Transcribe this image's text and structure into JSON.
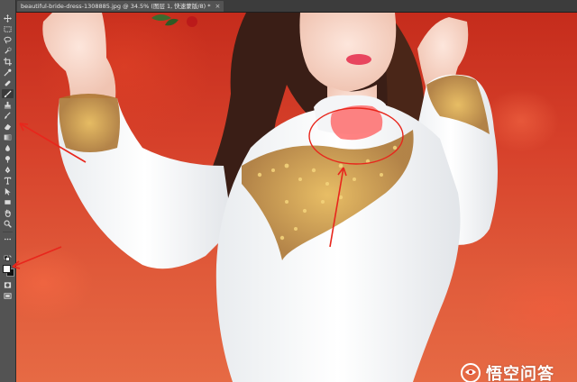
{
  "document_tab": {
    "title": "beautiful-bride-dress-1308885.jpg @ 34.5% (图层 1, 快速蒙版/8) *",
    "close_glyph": "×"
  },
  "toolbar": {
    "tools": [
      {
        "name": "move-tool-icon"
      },
      {
        "name": "marquee-tool-icon"
      },
      {
        "name": "lasso-tool-icon"
      },
      {
        "name": "quick-selection-tool-icon"
      },
      {
        "name": "crop-tool-icon"
      },
      {
        "name": "eyedropper-tool-icon"
      },
      {
        "name": "healing-brush-tool-icon"
      },
      {
        "name": "brush-tool-icon",
        "active": true
      },
      {
        "name": "clone-stamp-tool-icon"
      },
      {
        "name": "history-brush-tool-icon"
      },
      {
        "name": "eraser-tool-icon"
      },
      {
        "name": "gradient-tool-icon"
      },
      {
        "name": "blur-tool-icon"
      },
      {
        "name": "dodge-tool-icon"
      },
      {
        "name": "pen-tool-icon"
      },
      {
        "name": "type-tool-icon"
      },
      {
        "name": "path-selection-tool-icon"
      },
      {
        "name": "rectangle-tool-icon"
      },
      {
        "name": "hand-tool-icon"
      },
      {
        "name": "zoom-tool-icon"
      },
      {
        "name": "more-tools-icon"
      }
    ],
    "foreground_color": "#ffffff",
    "background_color": "#111111"
  },
  "canvas": {
    "background_color": "#d23a26",
    "quick_mask_overlay_color": "#ff5a5a"
  },
  "annotations": {
    "color": "#e8261c"
  },
  "watermark": {
    "text": "悟空问答"
  }
}
